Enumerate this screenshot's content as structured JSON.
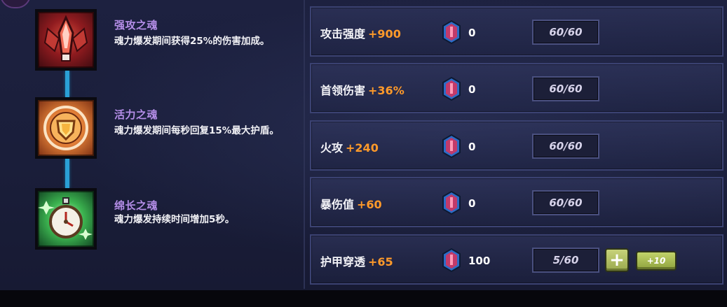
{
  "skills": [
    {
      "name": "强攻之魂",
      "desc": "魂力爆发期间获得25%的伤害加成。",
      "icon": "attack-soul-icon"
    },
    {
      "name": "活力之魂",
      "desc": "魂力爆发期间每秒回复15%最大护盾。",
      "icon": "vitality-soul-icon"
    },
    {
      "name": "绵长之魂",
      "desc": "魂力爆发持续时间增加5秒。",
      "icon": "duration-soul-icon"
    }
  ],
  "stats": [
    {
      "label": "攻击强度",
      "bonus": "+900",
      "gems": "0",
      "progress": "60/60"
    },
    {
      "label": "首领伤害",
      "bonus": "+36%",
      "gems": "0",
      "progress": "60/60"
    },
    {
      "label": "火攻",
      "bonus": "+240",
      "gems": "0",
      "progress": "60/60"
    },
    {
      "label": "暴伤值",
      "bonus": "+60",
      "gems": "0",
      "progress": "60/60"
    },
    {
      "label": "护甲穿透",
      "bonus": "+65",
      "gems": "100",
      "progress": "5/60"
    }
  ],
  "buttons": {
    "plus": "+",
    "plus10": "+10"
  },
  "colors": {
    "skill_name": "#b58ee8",
    "bonus": "#ff9a2a",
    "connector": "#2aa0d6",
    "button_green": "#b5c563"
  }
}
